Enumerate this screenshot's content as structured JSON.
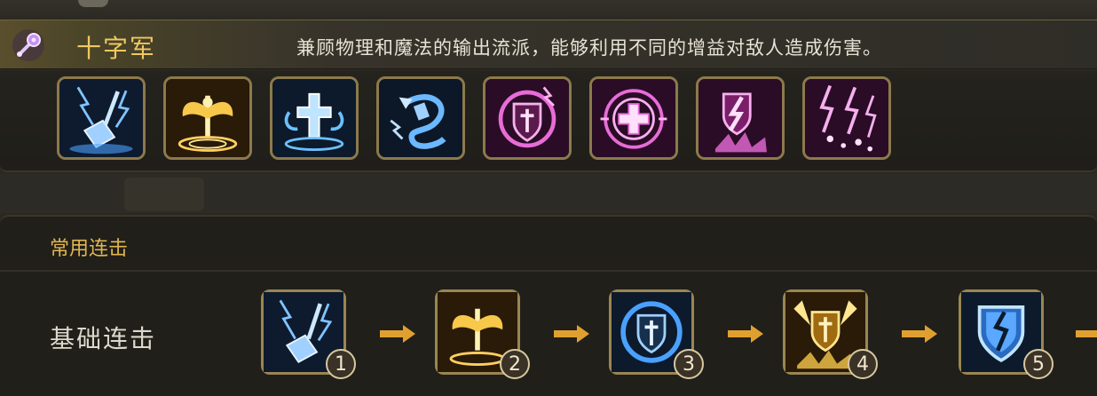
{
  "header": {
    "title": "十字军",
    "description": "兼顾物理和魔法的输出流派，能够利用不同的增益对敌人造成伤害。",
    "icon": "mace-icon"
  },
  "skills": [
    {
      "icon": "thunder-hammer-icon",
      "color": "#5aa8ff"
    },
    {
      "icon": "angel-wings-icon",
      "color": "#f3c24a"
    },
    {
      "icon": "holy-cross-pillar-icon",
      "color": "#6cc0ff"
    },
    {
      "icon": "lightning-dragon-icon",
      "color": "#5aa8ff"
    },
    {
      "icon": "cross-shield-icon",
      "color": "#e86cd8"
    },
    {
      "icon": "holy-circle-icon",
      "color": "#e86cd8"
    },
    {
      "icon": "lightning-burst-icon",
      "color": "#e86cd8"
    },
    {
      "icon": "sparkle-strike-icon",
      "color": "#e86cd8"
    }
  ],
  "combo": {
    "section_title": "常用连击",
    "row_label": "基础连击",
    "steps": [
      {
        "number": "1",
        "icon": "thunder-hammer-icon",
        "color": "#5aa8ff"
      },
      {
        "number": "2",
        "icon": "angel-wings-icon",
        "color": "#f3c24a"
      },
      {
        "number": "3",
        "icon": "cross-shield-swirl-icon",
        "color": "#5aa8ff"
      },
      {
        "number": "4",
        "icon": "golden-shield-icon",
        "color": "#f3c24a"
      },
      {
        "number": "5",
        "icon": "cracked-shield-icon",
        "color": "#5aa8ff"
      }
    ]
  }
}
